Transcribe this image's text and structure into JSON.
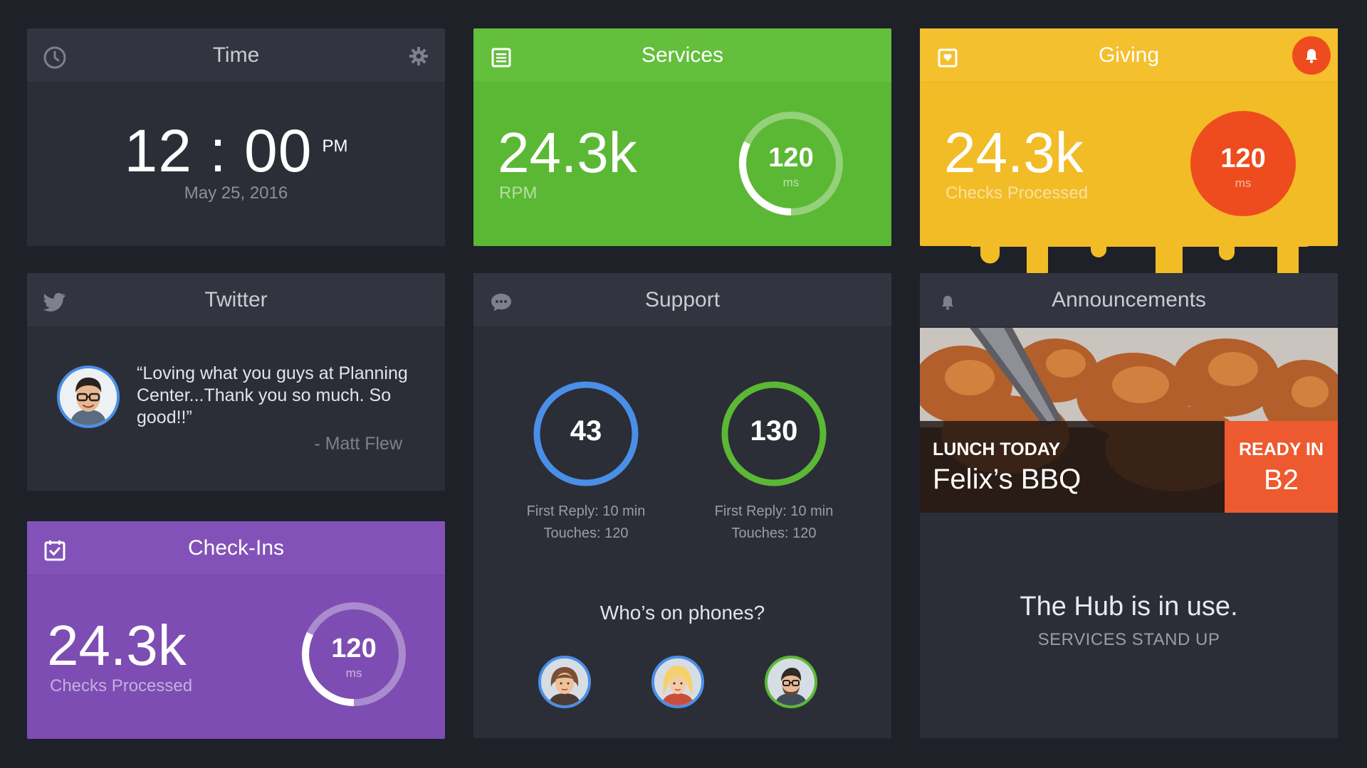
{
  "time": {
    "title": "Time",
    "clock": "12 : 00",
    "ampm": "PM",
    "date": "May 25, 2016",
    "icon": "clock-icon",
    "settings_icon": "gear-icon"
  },
  "services": {
    "title": "Services",
    "value": "24.3k",
    "label": "RPM",
    "ring_value": "120",
    "ring_unit": "ms",
    "ring_level": 0.32,
    "color": "#5bb834",
    "icon": "document-icon"
  },
  "giving": {
    "title": "Giving",
    "value": "24.3k",
    "label": "Checks Processed",
    "ring_value": "120",
    "ring_unit": "ms",
    "color": "#f2bc27",
    "alert_color": "#ee4c1e",
    "icon": "heart-icon",
    "alert_icon": "bell-icon"
  },
  "twitter": {
    "title": "Twitter",
    "quote": "“Loving what you guys at Planning Center...Thank you so much. So good!!”",
    "author": "- Matt Flew",
    "icon": "bird-icon"
  },
  "support": {
    "title": "Support",
    "icon": "chat-icon",
    "stats": [
      {
        "value": "43",
        "reply": "First Reply: 10 min",
        "touches": "Touches: 120",
        "color": "#4a8fe7"
      },
      {
        "value": "130",
        "reply": "First Reply: 10 min",
        "touches": "Touches: 120",
        "color": "#5bb834"
      }
    ],
    "phones_title": "Who’s on phones?"
  },
  "announcements": {
    "title": "Announcements",
    "icon": "bell-icon",
    "lunch_label": "LUNCH TODAY",
    "lunch_name": "Felix’s BBQ",
    "ready_label": "READY IN",
    "ready_room": "B2",
    "hub_main": "The Hub is in use.",
    "hub_sub": "SERVICES STAND UP"
  },
  "checkins": {
    "title": "Check-Ins",
    "value": "24.3k",
    "label": "Checks Processed",
    "ring_value": "120",
    "ring_unit": "ms",
    "ring_level": 0.32,
    "color": "#7d4db3",
    "icon": "checkbox-icon"
  }
}
